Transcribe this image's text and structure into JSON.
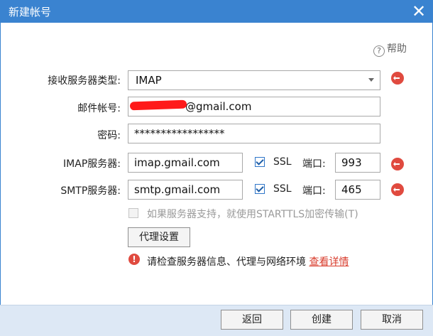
{
  "window": {
    "title": "新建帐号"
  },
  "help": {
    "label": "帮助"
  },
  "form": {
    "server_type": {
      "label": "接收服务器类型:",
      "value": "IMAP"
    },
    "email": {
      "label": "邮件帐号:",
      "value": "@gmail.com"
    },
    "password": {
      "label": "密码:",
      "value": "*****************"
    },
    "imap": {
      "label": "IMAP服务器:",
      "server": "imap.gmail.com",
      "ssl_label": "SSL",
      "ssl_checked": true,
      "port_label": "端口:",
      "port": "993"
    },
    "smtp": {
      "label": "SMTP服务器:",
      "server": "smtp.gmail.com",
      "ssl_label": "SSL",
      "ssl_checked": true,
      "port_label": "端口:",
      "port": "465"
    },
    "starttls": {
      "label": "如果服务器支持，就使用STARTTLS加密传输(T)",
      "checked": false
    }
  },
  "proxy_button": "代理设置",
  "error": {
    "message": "请检查服务器信息、代理与网络环境",
    "link": "查看详情"
  },
  "footer": {
    "back": "返回",
    "create": "创建",
    "cancel": "取消"
  },
  "colors": {
    "titlebar": "#3a83d0",
    "footer": "#dde8f5",
    "error": "#e04a3f",
    "link": "#d83b2b"
  }
}
